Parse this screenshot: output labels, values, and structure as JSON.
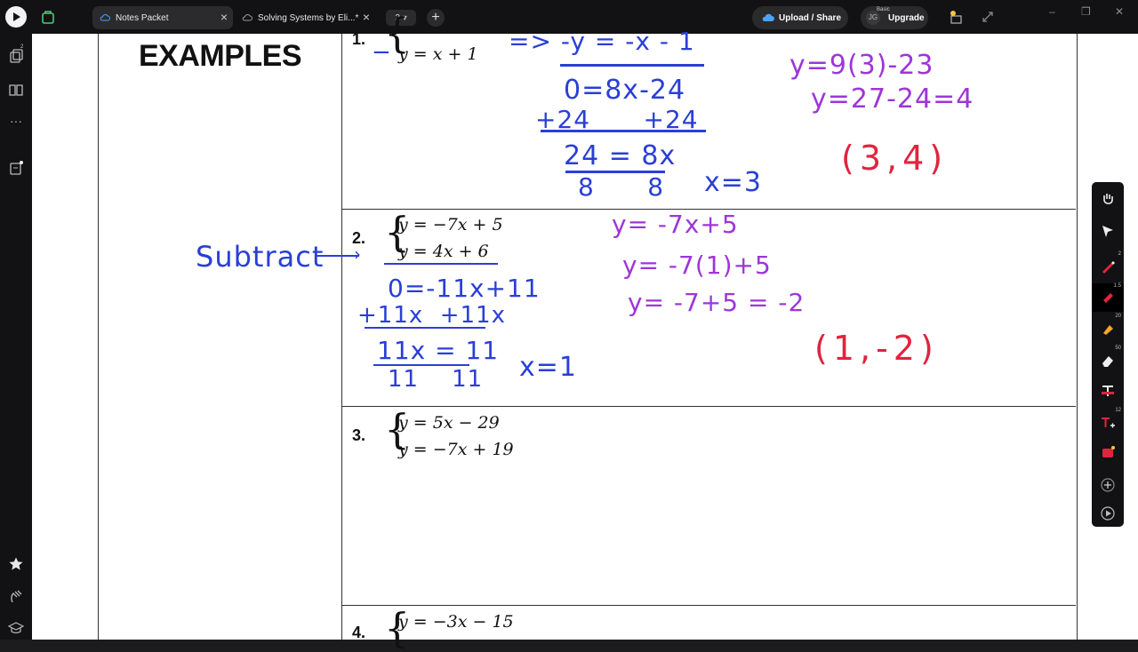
{
  "tabs": [
    {
      "label": "Notes Packet",
      "active": true
    },
    {
      "label": "Solving Systems by Eli...*",
      "active": false
    }
  ],
  "tab_count": "2",
  "upload_label": "Upload / Share",
  "upgrade": {
    "avatar": "JG",
    "badge": "Basic",
    "label": "Upgrade"
  },
  "left_badges": {
    "pages": "2"
  },
  "toolbar_values": {
    "pen_size": "2",
    "marker_size": "1.5",
    "highlighter_size": "20",
    "eraser_size": "50",
    "text_size": "12"
  },
  "heading": "EXAMPLES",
  "problems": [
    {
      "number": "1.",
      "eq2": "y = x + 1"
    },
    {
      "number": "2.",
      "eq1": "y = −7x + 5",
      "eq2": "y = 4x + 6"
    },
    {
      "number": "3.",
      "eq1": "y = 5x − 29",
      "eq2": "y = −7x + 19"
    },
    {
      "number": "4.",
      "eq1": "y = −3x − 15"
    }
  ],
  "handwriting": {
    "p1": {
      "top_work": "=> -y = -x - 1",
      "l1": "0=8x-24",
      "l2": "+24      +24",
      "l3": "24 = 8x",
      "l4": "8      8",
      "x": "x=3",
      "sub1": "y=9(3)-23",
      "sub2": "y=27-24=4",
      "answer": "(3,4)"
    },
    "p2": {
      "note": "Subtract",
      "l1": "0=-11x+11",
      "l2": "+11x  +11x",
      "l3": "11x = 11",
      "l4": "11    11",
      "x": "x=1",
      "sub0": "y= -7x+5",
      "sub1": "y= -7(1)+5",
      "sub2": "y= -7+5 = -2",
      "answer": "(1,-2)"
    }
  },
  "colors": {
    "blue_ink": "#2a3fd6",
    "purple_ink": "#9d36d8",
    "red_ink": "#e0243d",
    "chrome": "#121214"
  }
}
